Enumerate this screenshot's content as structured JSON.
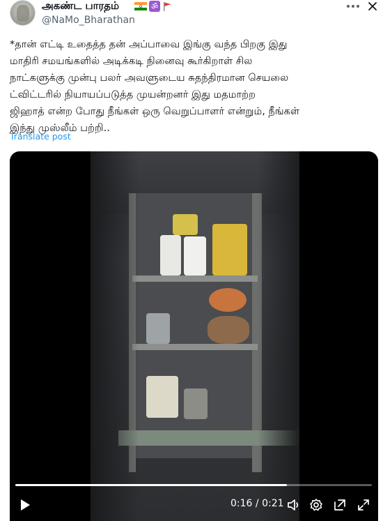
{
  "author": {
    "display_name": "அகண்ட பாரதம்",
    "handle": "@NaMo_Bharathan",
    "badges": [
      "india-flag-icon",
      "om-icon",
      "red-flag-icon"
    ]
  },
  "tweet": {
    "text": "*தான் எட்டி உதைத்த தன் அப்பாவை இங்கு வந்த பிறகு இது\nமாதிரி சமயங்களில் அடிக்கடி நினைவு கூர்கிறாள் சில\nநாட்களுக்கு முன்பு பலர் அவளுடைய சுதந்திரமான செயலை\nட்விட்டரில் நியாயப்படுத்த முயன்றனர் இது மதமாற்ற\nஜிஹாத் என்ற போது நீங்கள் ஒரு வெறுப்பாளர் என்றும், நீங்கள்\nஇந்து முஸ்லீம் பற்றி..",
    "translate_label": "Translate post"
  },
  "video": {
    "current_time": "0:16",
    "separator": " / ",
    "duration": "0:21",
    "progress_fraction": 0.762
  },
  "colors": {
    "link": "#1d9bf0",
    "secondary_text": "#536471",
    "om_badge": "#9b59d0"
  }
}
